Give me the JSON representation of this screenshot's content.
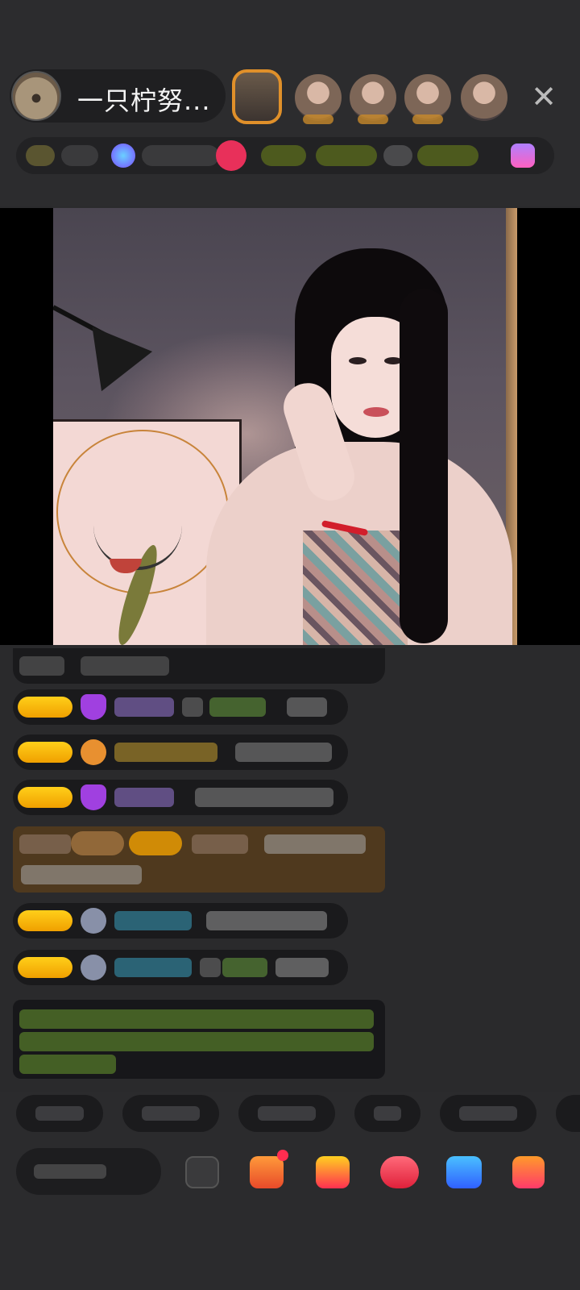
{
  "header": {
    "host_name": "一只柠努...",
    "close_symbol": "✕"
  },
  "icons": {
    "close": "close-icon",
    "gift": "gift-icon",
    "emoji": "emoji-icon"
  },
  "colors": {
    "level_badge": "#f0a000",
    "host_ring": "#e0902a",
    "notification_dot": "#ff2d50",
    "gem_purple": "#a040e0"
  }
}
